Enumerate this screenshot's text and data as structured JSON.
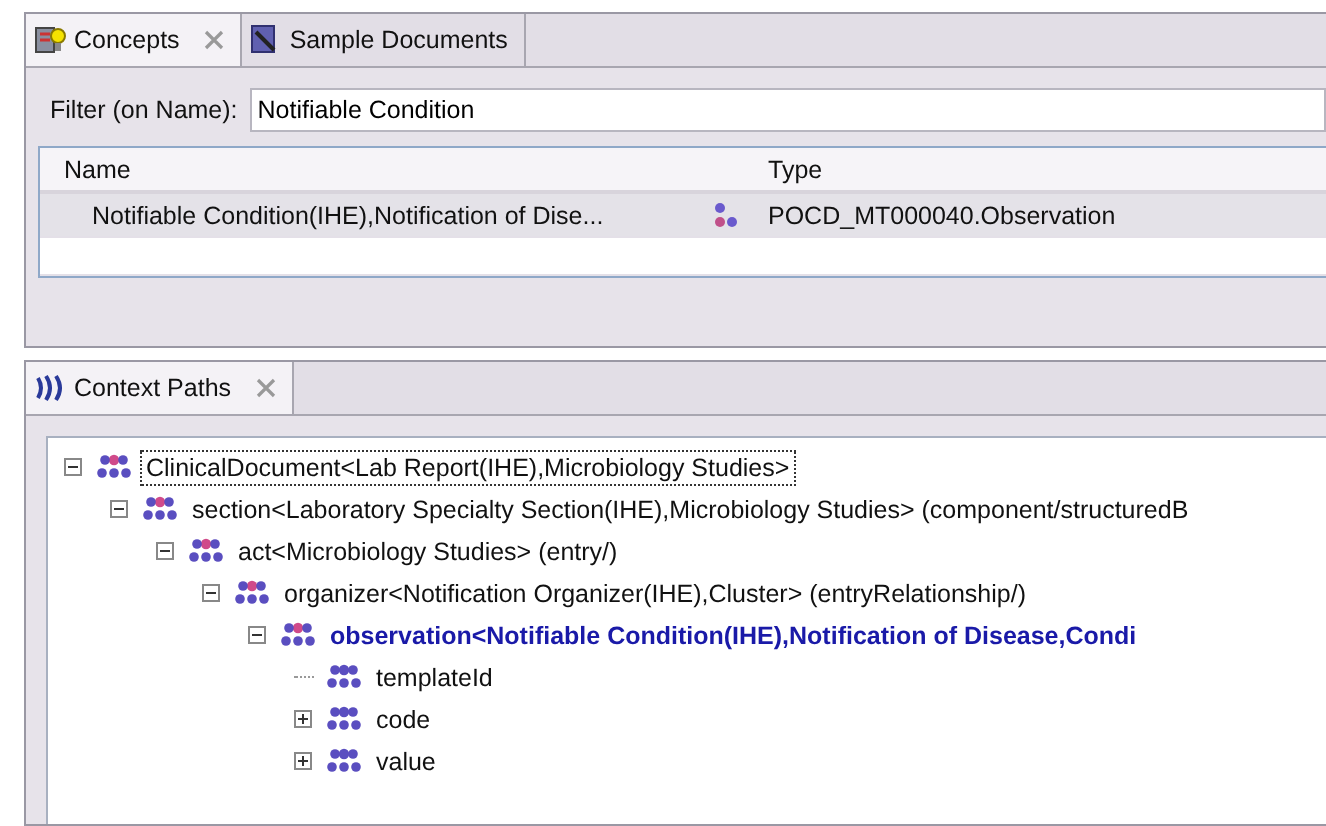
{
  "concepts_panel": {
    "tabs": [
      {
        "label": "Concepts",
        "selected": true,
        "closable": true
      },
      {
        "label": "Sample Documents",
        "selected": false,
        "closable": false
      }
    ],
    "filter": {
      "label": "Filter (on Name):",
      "value": "Notifiable Condition"
    },
    "table": {
      "columns": [
        "Name",
        "Type"
      ],
      "rows": [
        {
          "name": "Notifiable Condition(IHE),Notification of Dise...",
          "type": "POCD_MT000040.Observation",
          "selected": true
        }
      ]
    }
  },
  "context_paths_panel": {
    "tab": {
      "label": "Context Paths",
      "selected": true
    },
    "tree": [
      {
        "label": "ClinicalDocument<Lab Report(IHE),Microbiology Studies>",
        "expanded": true,
        "focused": true,
        "emphasized": false,
        "children": [
          {
            "label": "section<Laboratory Specialty Section(IHE),Microbiology Studies> (component/structuredB",
            "expanded": true,
            "focused": false,
            "emphasized": false,
            "children": [
              {
                "label": "act<Microbiology Studies> (entry/)",
                "expanded": true,
                "focused": false,
                "emphasized": false,
                "children": [
                  {
                    "label": "organizer<Notification Organizer(IHE),Cluster> (entryRelationship/)",
                    "expanded": true,
                    "focused": false,
                    "emphasized": false,
                    "children": [
                      {
                        "label": "observation<Notifiable Condition(IHE),Notification of Disease,Condi",
                        "expanded": true,
                        "focused": false,
                        "emphasized": true,
                        "children": [
                          {
                            "label": "templateId",
                            "focused": false,
                            "emphasized": false
                          },
                          {
                            "label": "code",
                            "expanded": false,
                            "focused": false,
                            "emphasized": false
                          },
                          {
                            "label": "value",
                            "expanded": false,
                            "focused": false,
                            "emphasized": false
                          }
                        ]
                      }
                    ]
                  }
                ]
              }
            ]
          }
        ]
      }
    ]
  }
}
